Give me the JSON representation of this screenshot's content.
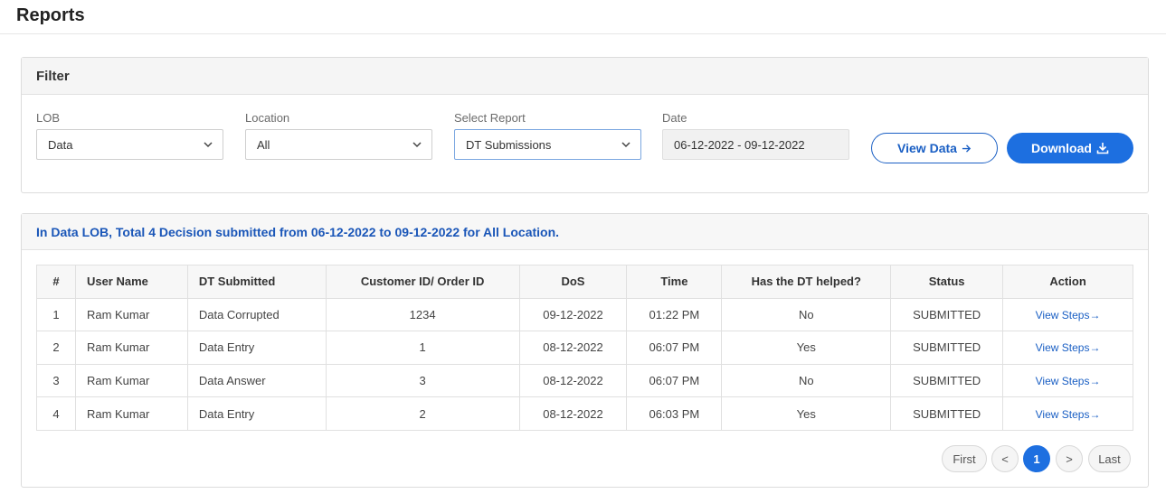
{
  "page": {
    "title": "Reports"
  },
  "filter": {
    "title": "Filter",
    "lob": {
      "label": "LOB",
      "value": "Data"
    },
    "location": {
      "label": "Location",
      "value": "All"
    },
    "report": {
      "label": "Select Report",
      "value": "DT Submissions"
    },
    "date": {
      "label": "Date",
      "value": "06-12-2022 - 09-12-2022"
    },
    "view_label": "View Data",
    "download_label": "Download"
  },
  "summary": "In Data LOB, Total 4 Decision submitted from 06-12-2022 to 09-12-2022 for All Location.",
  "table": {
    "headers": [
      "#",
      "User Name",
      "DT Submitted",
      "Customer ID/ Order ID",
      "DoS",
      "Time",
      "Has the DT helped?",
      "Status",
      "Action"
    ],
    "rows": [
      [
        "1",
        "Ram Kumar",
        "Data Corrupted",
        "1234",
        "09-12-2022",
        "01:22 PM",
        "No",
        "SUBMITTED",
        "View Steps"
      ],
      [
        "2",
        "Ram Kumar",
        "Data Entry",
        "1",
        "08-12-2022",
        "06:07 PM",
        "Yes",
        "SUBMITTED",
        "View Steps"
      ],
      [
        "3",
        "Ram Kumar",
        "Data Answer",
        "3",
        "08-12-2022",
        "06:07 PM",
        "No",
        "SUBMITTED",
        "View Steps"
      ],
      [
        "4",
        "Ram Kumar",
        "Data Entry",
        "2",
        "08-12-2022",
        "06:03 PM",
        "Yes",
        "SUBMITTED",
        "View Steps"
      ]
    ]
  },
  "pagination": {
    "first": "First",
    "prev": "<",
    "current": "1",
    "next": ">",
    "last": "Last"
  }
}
